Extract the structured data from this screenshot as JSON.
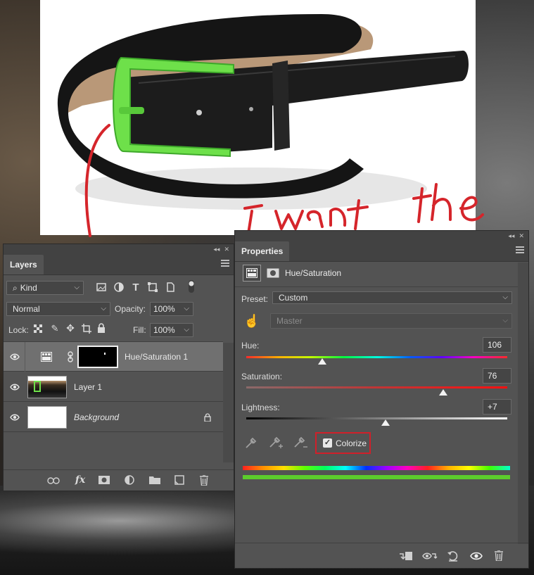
{
  "canvas": {
    "annotation_text": "I want the"
  },
  "layers_panel": {
    "tab_label": "Layers",
    "filter_kind": "Kind",
    "blend_mode": "Normal",
    "opacity_label": "Opacity:",
    "opacity_value": "100%",
    "lock_label": "Lock:",
    "fill_label": "Fill:",
    "fill_value": "100%",
    "layers": [
      {
        "name": "Hue/Saturation 1",
        "selected": true,
        "type": "adjustment"
      },
      {
        "name": "Layer 1",
        "selected": false,
        "type": "pixel"
      },
      {
        "name": "Background",
        "selected": false,
        "type": "background",
        "locked": true
      }
    ],
    "footer_icons": [
      "link-icon",
      "fx-icon",
      "mask-icon",
      "adjustment-icon",
      "folder-icon",
      "new-layer-icon",
      "trash-icon"
    ]
  },
  "properties_panel": {
    "tab_label": "Properties",
    "adjustment_title": "Hue/Saturation",
    "preset_label": "Preset:",
    "preset_value": "Custom",
    "channel_value": "Master",
    "hue_label": "Hue:",
    "hue_value": "106",
    "saturation_label": "Saturation:",
    "saturation_value": "76",
    "lightness_label": "Lightness:",
    "lightness_value": "+7",
    "colorize_label": "Colorize",
    "colorize_checked": true,
    "highlight_color": "#d0202a",
    "colorize_result_color": "#5ccd2c"
  }
}
